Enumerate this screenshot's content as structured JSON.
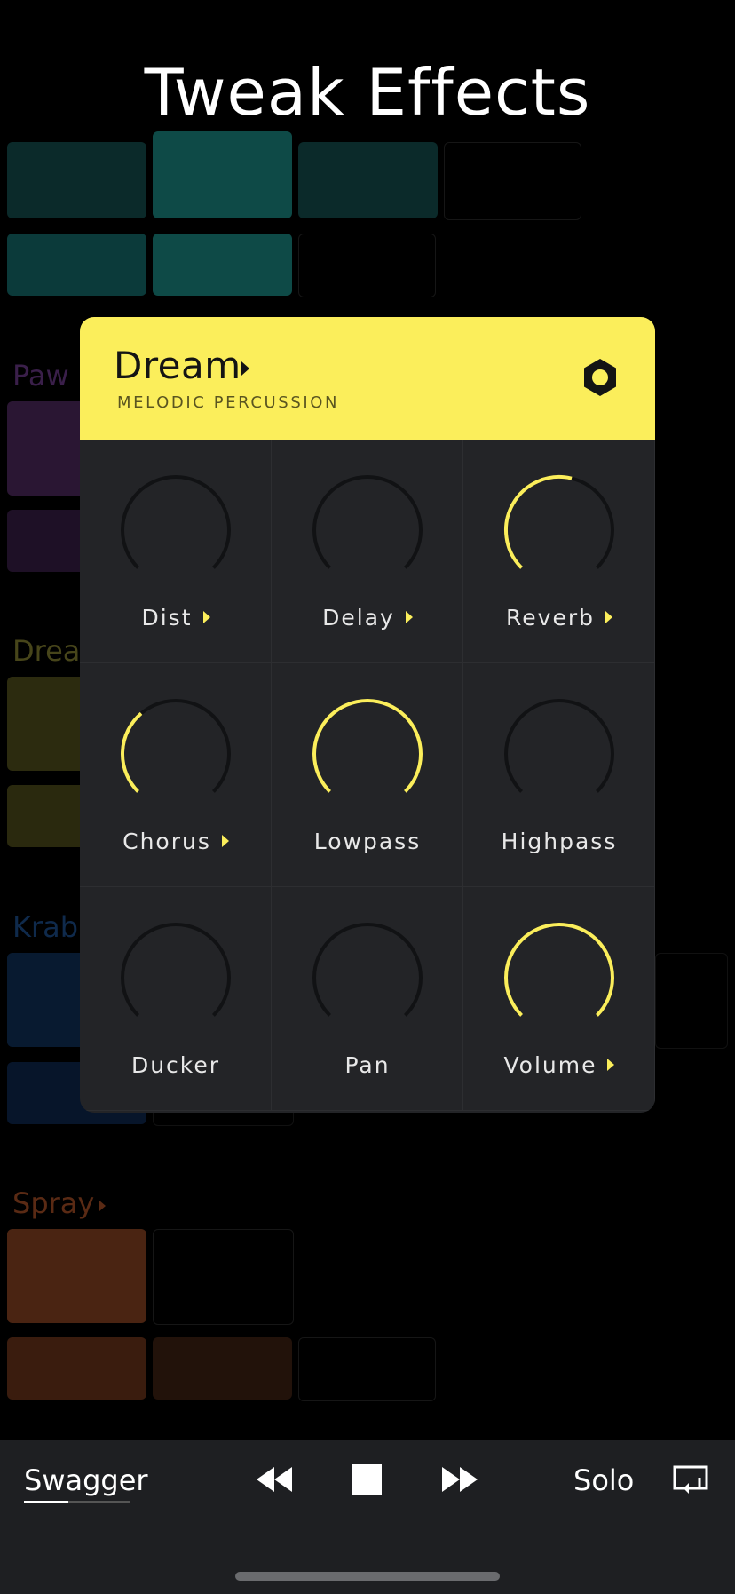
{
  "page": {
    "title": "Tweak Effects"
  },
  "background_tracks": [
    {
      "label": "Paw",
      "color": "#3a1f4a"
    },
    {
      "label": "Drea",
      "color": "#47451a"
    },
    {
      "label": "Krab",
      "color": "#0f2a4c"
    },
    {
      "label": "Spray",
      "color": "#5a2a14"
    }
  ],
  "instrument": {
    "name": "Dream",
    "category": "MELODIC PERCUSSION",
    "settings_icon": "hexagon-nut-icon",
    "accent_color": "#fbee5b"
  },
  "effects": [
    {
      "label": "Dist",
      "value": 0.0,
      "has_submenu": true
    },
    {
      "label": "Delay",
      "value": 0.0,
      "has_submenu": true
    },
    {
      "label": "Reverb",
      "value": 0.55,
      "has_submenu": true
    },
    {
      "label": "Chorus",
      "value": 0.35,
      "has_submenu": true
    },
    {
      "label": "Lowpass",
      "value": 1.0,
      "has_submenu": false
    },
    {
      "label": "Highpass",
      "value": 0.0,
      "has_submenu": false
    },
    {
      "label": "Ducker",
      "value": 0.0,
      "has_submenu": false
    },
    {
      "label": "Pan",
      "value": 0.0,
      "has_submenu": false
    },
    {
      "label": "Volume",
      "value": 1.0,
      "has_submenu": true
    }
  ],
  "transport": {
    "song": "Swagger",
    "rewind_icon": "rewind-icon",
    "stop_icon": "stop-icon",
    "forward_icon": "fast-forward-icon",
    "solo": "Solo",
    "airplay_icon": "screen-return-icon"
  }
}
